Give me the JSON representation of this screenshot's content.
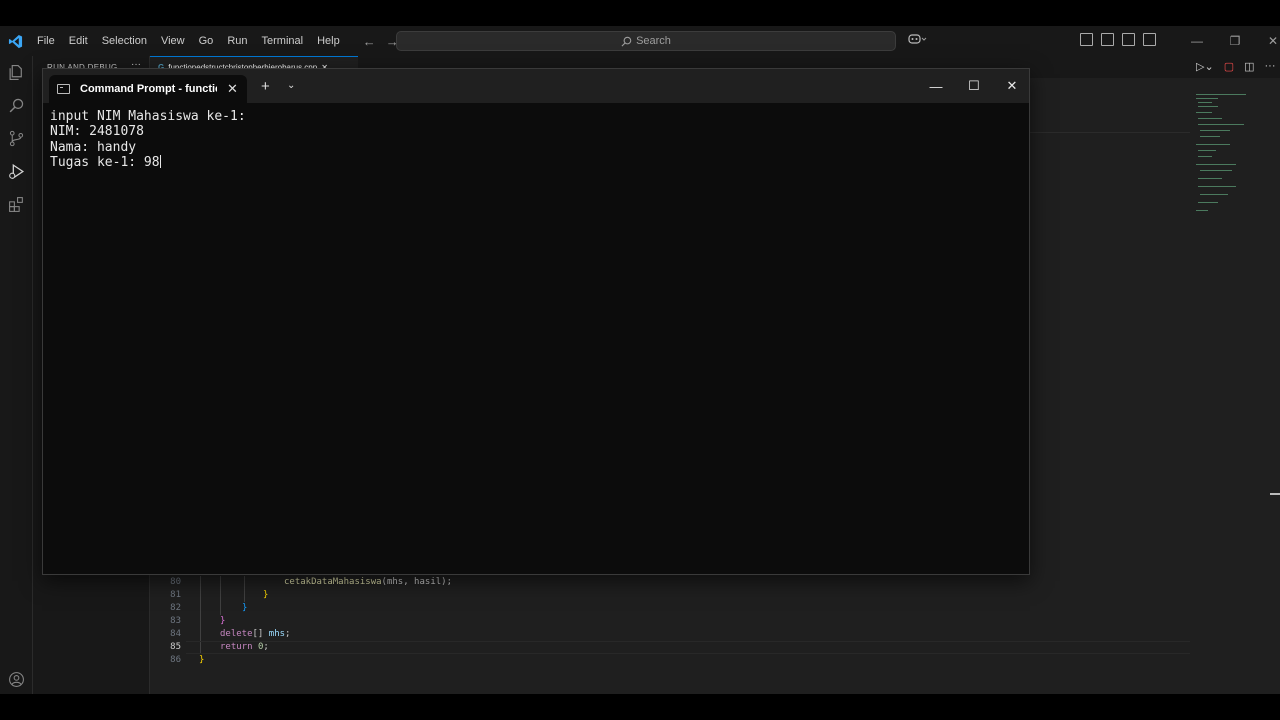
{
  "vscode": {
    "menu": [
      "File",
      "Edit",
      "Selection",
      "View",
      "Go",
      "Run",
      "Terminal",
      "Help"
    ],
    "search_placeholder": "Search",
    "sidebar_title": "RUN AND DEBUG",
    "sidebar_more": "···",
    "active_tab": "functionedstructchristopherhierobarus.cpp",
    "accent": "#0078d4",
    "code_lines": [
      {
        "num": "80",
        "text": "cetakDataMahasiswa(mhs, hasil);"
      },
      {
        "num": "81",
        "text": "}"
      },
      {
        "num": "82",
        "text": "}"
      },
      {
        "num": "83",
        "text": "}"
      },
      {
        "num": "84",
        "text": "delete[] mhs;"
      },
      {
        "num": "85",
        "text": "return 0;"
      },
      {
        "num": "86",
        "text": "}"
      }
    ],
    "code_parts": {
      "l80_fn": "cetakDataMahasiswa",
      "l80_args": "(mhs, hasil);",
      "l84_kw": "delete",
      "l84_rest": "[] ",
      "l84_var": "mhs",
      "l84_end": ";",
      "l85_kw": "return",
      "l85_num": "0",
      "l85_end": ";"
    }
  },
  "cmd": {
    "tab_title": "Command Prompt - functione",
    "close_glyph": "✕",
    "new_tab_glyph": "+",
    "dropdown_glyph": "⌄",
    "lines": [
      "input NIM Mahasiswa ke-1:",
      "NIM: 2481078",
      "Nama: handy",
      "Tugas ke-1: 98"
    ]
  }
}
